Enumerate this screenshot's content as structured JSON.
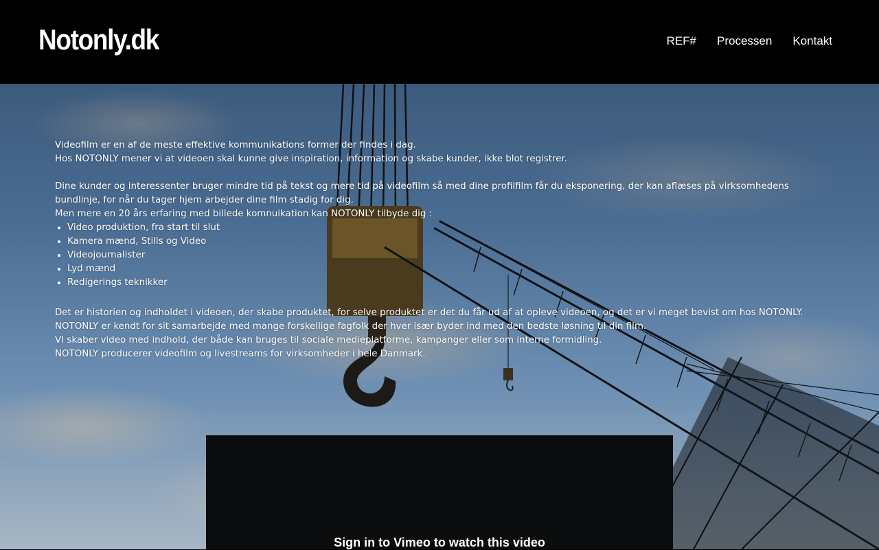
{
  "header": {
    "logo": "Notonly.dk",
    "nav": [
      "REF#",
      "Processen",
      "Kontakt"
    ]
  },
  "main": {
    "intro": [
      "Videofilm er en af de meste effektive kommunikations former der findes i dag.",
      "Hos NOTONLY mener vi at videoen skal kunne give inspiration, information og skabe kunder, ikke blot registrer."
    ],
    "para2": "Dine kunder og interessenter bruger mindre tid på tekst og mere tid på videofilm så med dine profilfilm får du eksponering, der kan aflæses på virksomhedens bundlinje, for når du tager hjem arbejder dine film stadig for dig.",
    "list_intro": "Men mere en 20 års erfaring med billede komnuikation kan NOTONLY tilbyde dig :",
    "services": [
      "Video produktion, fra start til slut",
      "Kamera mænd, Stills og Video",
      "Videojournalister",
      "Lyd mænd",
      "Redigerings teknikker"
    ],
    "outro": [
      "Det er historien og indholdet i videoen, der skabe produktet, for selve produktet er det du får ud af at opleve videoen, og det er vi meget bevist om hos NOTONLY.",
      "NOTONLY er kendt for sit samarbejde med mange forskellige fagfolk der hver især byder ind med den bedste løsning til din film.",
      "VI skaber video med indhold, der både kan bruges til sociale medieplatforme, kampanger eller som interne formidling.",
      "NOTONLY producerer videofilm og livestreams for virksomheder i hele Danmark."
    ]
  },
  "video": {
    "message": "Sign in to Vimeo to watch this video"
  },
  "colors": {
    "header_bg": "#000000",
    "text": "#ffffff",
    "video_bg": "#0b0c0d"
  }
}
